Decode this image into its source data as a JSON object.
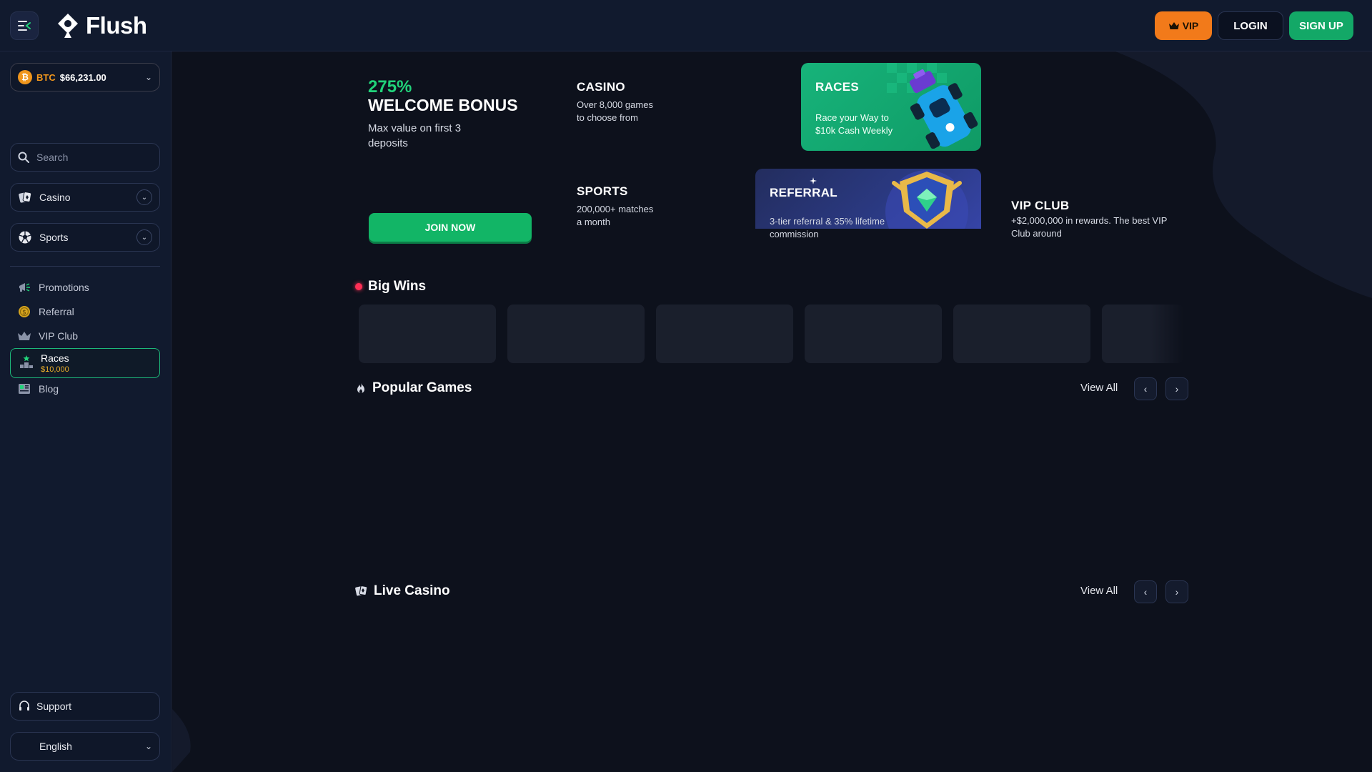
{
  "header": {
    "brand": "Flush",
    "vip_label": "VIP",
    "login_label": "LOGIN",
    "signup_label": "SIGN UP"
  },
  "sidebar": {
    "balance": {
      "currency": "BTC",
      "amount": "$66,231.00"
    },
    "search": {
      "placeholder": "Search"
    },
    "casino_label": "Casino",
    "sports_label": "Sports",
    "nav": [
      {
        "label": "Promotions",
        "icon": "megaphone-icon"
      },
      {
        "label": "Referral",
        "icon": "coin-icon"
      },
      {
        "label": "VIP Club",
        "icon": "crown-icon"
      },
      {
        "label": "Races",
        "sub": "$10,000",
        "icon": "podium-icon"
      },
      {
        "label": "Blog",
        "icon": "newspaper-icon"
      }
    ],
    "support_label": "Support",
    "language": "English"
  },
  "promos": {
    "bonus": {
      "percent": "275%",
      "title": "WELCOME BONUS",
      "subtitle": "Max value on first 3 deposits",
      "cta": "JOIN NOW"
    },
    "casino": {
      "title": "CASINO",
      "desc": "Over 8,000 games to choose from"
    },
    "races": {
      "title": "RACES",
      "desc": "Race your Way to $10k Cash Weekly"
    },
    "sports": {
      "title": "SPORTS",
      "desc": "200,000+ matches a month"
    },
    "referral": {
      "title": "REFERRAL",
      "desc": "3-tier referral & 35% lifetime commission"
    },
    "vip": {
      "title": "VIP CLUB",
      "desc": "+$2,000,000 in rewards. The best VIP Club around"
    }
  },
  "sections": {
    "big_wins": {
      "title": "Big Wins"
    },
    "popular_games": {
      "title": "Popular Games",
      "view_all": "View All"
    },
    "live_casino": {
      "title": "Live Casino",
      "view_all": "View All"
    }
  },
  "colors": {
    "accent_green": "#13a867",
    "vip_orange": "#f27a1a",
    "bonus_green": "#21d37a",
    "btc_orange": "#f0961c",
    "live_red": "#ff2f55"
  }
}
